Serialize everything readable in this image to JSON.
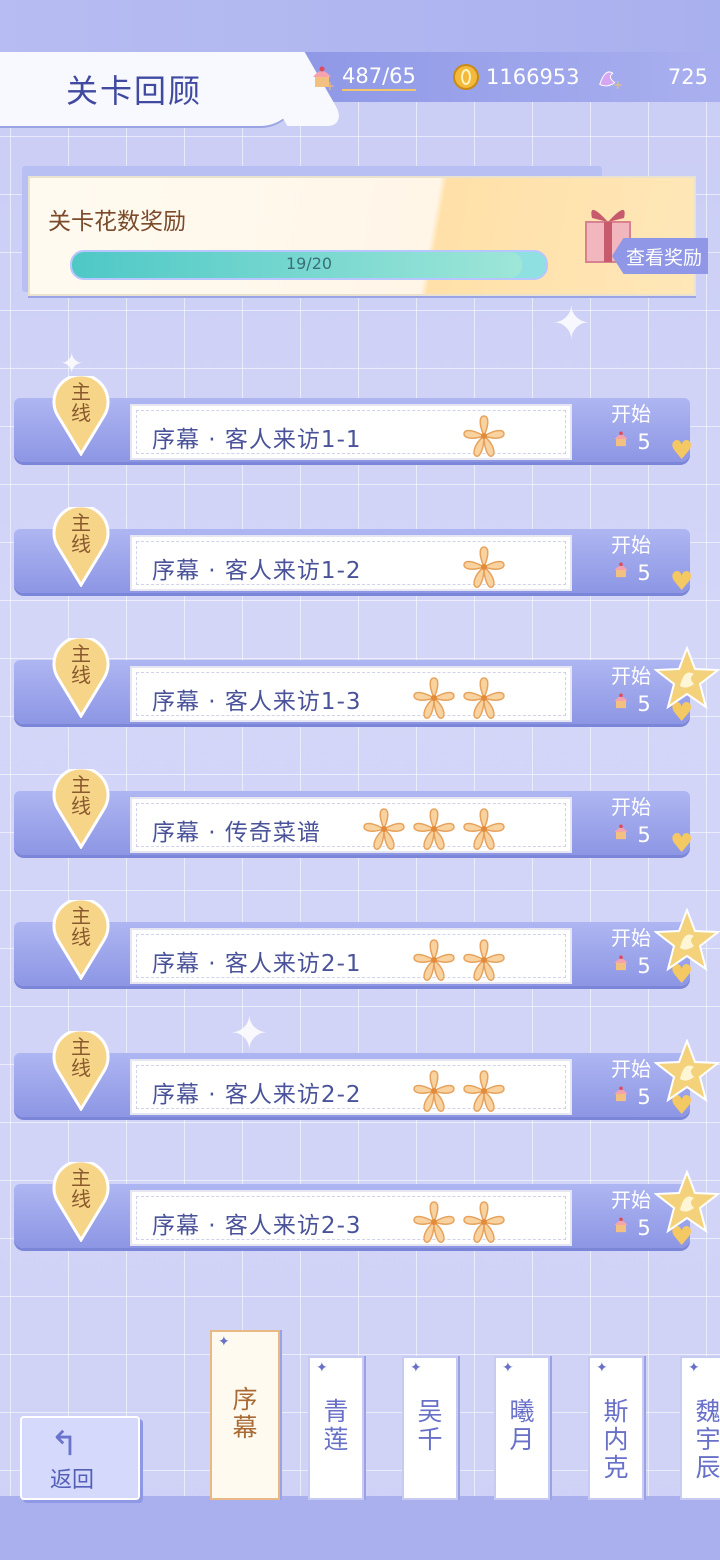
{
  "header": {
    "title": "关卡回顾",
    "resources": {
      "stamina": "487/65",
      "gold": "1166953",
      "gem": "725"
    }
  },
  "reward": {
    "label": "关卡花数奖励",
    "progress_text": "19/20",
    "progress_fraction": 0.95,
    "view_button": "查看奖励"
  },
  "levels": [
    {
      "badge": "主\n线",
      "name": "序幕 · 客人来访1-1",
      "flowers": 1,
      "start": "开始",
      "cost": "5",
      "star": false
    },
    {
      "badge": "主\n线",
      "name": "序幕 · 客人来访1-2",
      "flowers": 1,
      "start": "开始",
      "cost": "5",
      "star": false
    },
    {
      "badge": "主\n线",
      "name": "序幕 · 客人来访1-3",
      "flowers": 2,
      "start": "开始",
      "cost": "5",
      "star": true
    },
    {
      "badge": "主\n线",
      "name": "序幕 · 传奇菜谱",
      "flowers": 3,
      "start": "开始",
      "cost": "5",
      "star": false
    },
    {
      "badge": "主\n线",
      "name": "序幕 · 客人来访2-1",
      "flowers": 2,
      "start": "开始",
      "cost": "5",
      "star": true
    },
    {
      "badge": "主\n线",
      "name": "序幕 · 客人来访2-2",
      "flowers": 2,
      "start": "开始",
      "cost": "5",
      "star": true
    },
    {
      "badge": "主\n线",
      "name": "序幕 · 客人来访2-3",
      "flowers": 2,
      "start": "开始",
      "cost": "5",
      "star": true
    }
  ],
  "footer": {
    "back_label": "返回",
    "tabs": [
      {
        "label": "序\n幕",
        "active": true
      },
      {
        "label": "青\n莲",
        "active": false
      },
      {
        "label": "吴\n千",
        "active": false
      },
      {
        "label": "曦\n月",
        "active": false
      },
      {
        "label": "斯\n内\n克",
        "active": false
      },
      {
        "label": "魏\n宇\n辰",
        "active": false
      }
    ]
  },
  "icons": {
    "stamina": "cupcake-icon",
    "gold": "coin-icon",
    "gem": "swan-crystal-icon",
    "flower": "flower-icon",
    "star": "star-icon",
    "back": "back-arrow-icon"
  },
  "colors": {
    "accent": "#8d96e4",
    "title": "#3f4aa0",
    "progress": "#4ec8c6",
    "flower": "#f6c48a"
  }
}
